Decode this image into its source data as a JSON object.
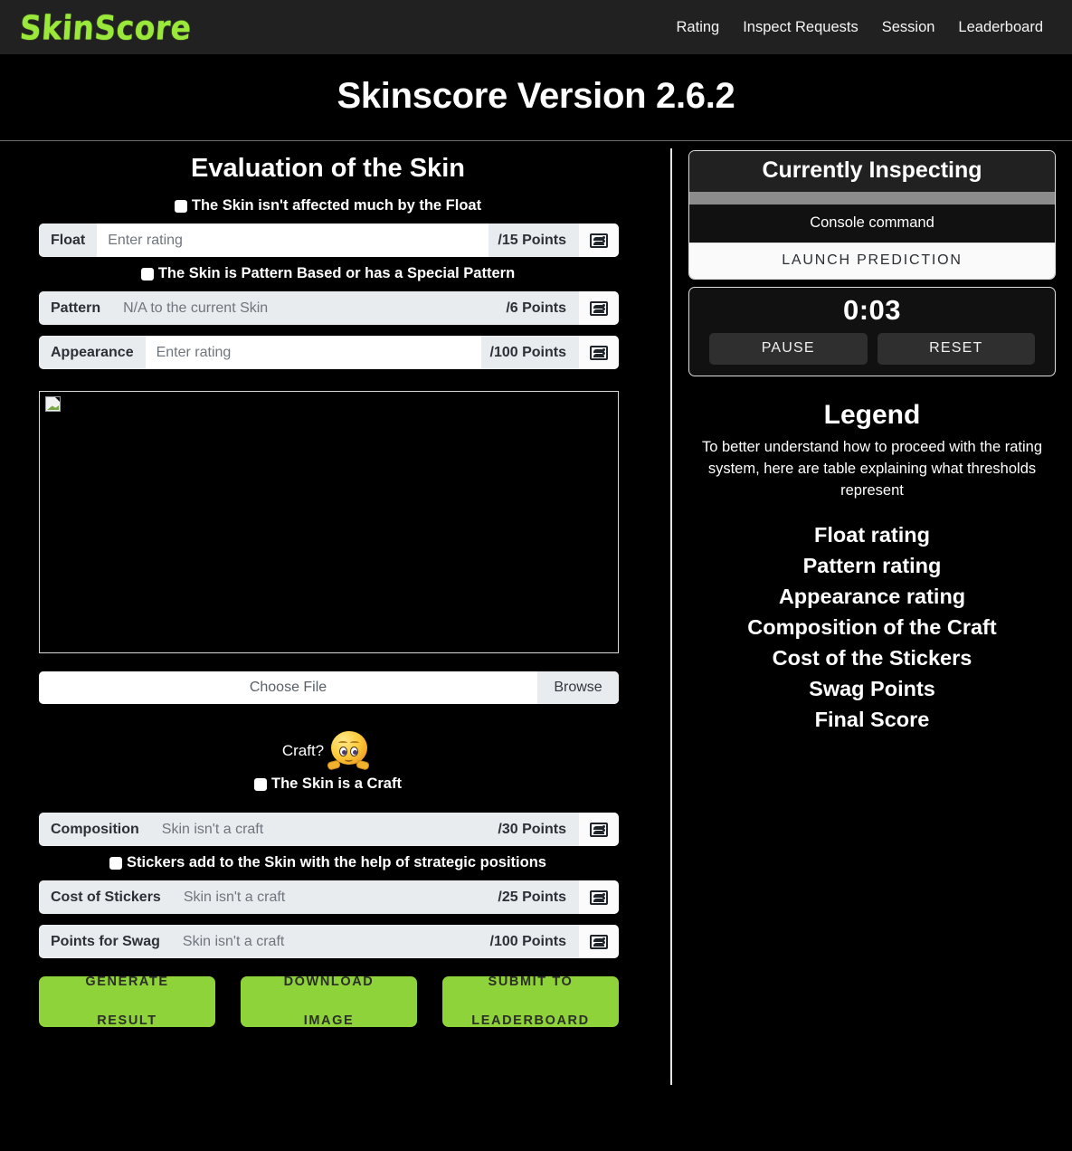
{
  "navbar": {
    "brand": "SkinScore",
    "links": [
      {
        "label": "Rating"
      },
      {
        "label": "Inspect Requests"
      },
      {
        "label": "Session"
      },
      {
        "label": "Leaderboard"
      }
    ]
  },
  "page": {
    "title": "Skinscore Version 2.6.2"
  },
  "evaluation": {
    "title": "Evaluation of the Skin",
    "float_check_label": "The Skin isn't affected much by the Float",
    "pattern_check_label": "The Skin is Pattern Based or has a Special Pattern",
    "craft_check_label": "The Skin is a Craft",
    "stickers_check_label": "Stickers add to the Skin with the help of strategic positions",
    "craft_question": "Craft?",
    "rows": [
      {
        "label": "Float",
        "placeholder": "Enter rating",
        "value": "",
        "points": "/15 Points",
        "icon": "people-icon",
        "disabled": false
      },
      {
        "label": "Pattern",
        "placeholder": "N/A to the current Skin",
        "value": "",
        "points": "/6 Points",
        "icon": "people-icon",
        "disabled": true
      },
      {
        "label": "Appearance",
        "placeholder": "Enter rating",
        "value": "",
        "points": "/100 Points",
        "icon": "people-icon",
        "disabled": false
      },
      {
        "label": "Composition",
        "placeholder": "Skin isn't a craft",
        "value": "",
        "points": "/30 Points",
        "icon": "people-icon",
        "disabled": true
      },
      {
        "label": "Cost of Stickers",
        "placeholder": "Skin isn't a craft",
        "value": "",
        "points": "/25 Points",
        "icon": "people-icon",
        "disabled": true
      },
      {
        "label": "Points for Swag",
        "placeholder": "Skin isn't a craft",
        "value": "",
        "points": "/100 Points",
        "icon": "people-icon",
        "disabled": true
      }
    ],
    "file_input": {
      "text": "Choose File",
      "button": "Browse"
    },
    "buttons": {
      "generate_line1": "GENERATE",
      "generate_line2": "RESULT",
      "download_line1": "DOWNLOAD",
      "download_line2": "IMAGE",
      "submit_line1": "SUBMIT TO",
      "submit_line2": "LEADERBOARD"
    }
  },
  "inspect": {
    "title": "Currently Inspecting",
    "console_placeholder": "Console command",
    "console_value": "",
    "launch_button": "LAUNCH PREDICTION"
  },
  "timer": {
    "value": "0:03",
    "pause_label": "PAUSE",
    "reset_label": "RESET"
  },
  "legend": {
    "title": "Legend",
    "description": "To better understand how to proceed with the rating system, here are table explaining what thresholds represent",
    "items": [
      {
        "label": "Float rating"
      },
      {
        "label": "Pattern rating"
      },
      {
        "label": "Appearance rating"
      },
      {
        "label": "Composition of the Craft"
      },
      {
        "label": "Cost of the Stickers"
      },
      {
        "label": "Swag Points"
      },
      {
        "label": "Final Score"
      }
    ]
  },
  "colors": {
    "accent_green": "#8ed339",
    "brand_green": "#9ae93a",
    "navbar_bg": "#212121",
    "page_bg": "#000000",
    "gray_bar": "#8b8b8b"
  }
}
